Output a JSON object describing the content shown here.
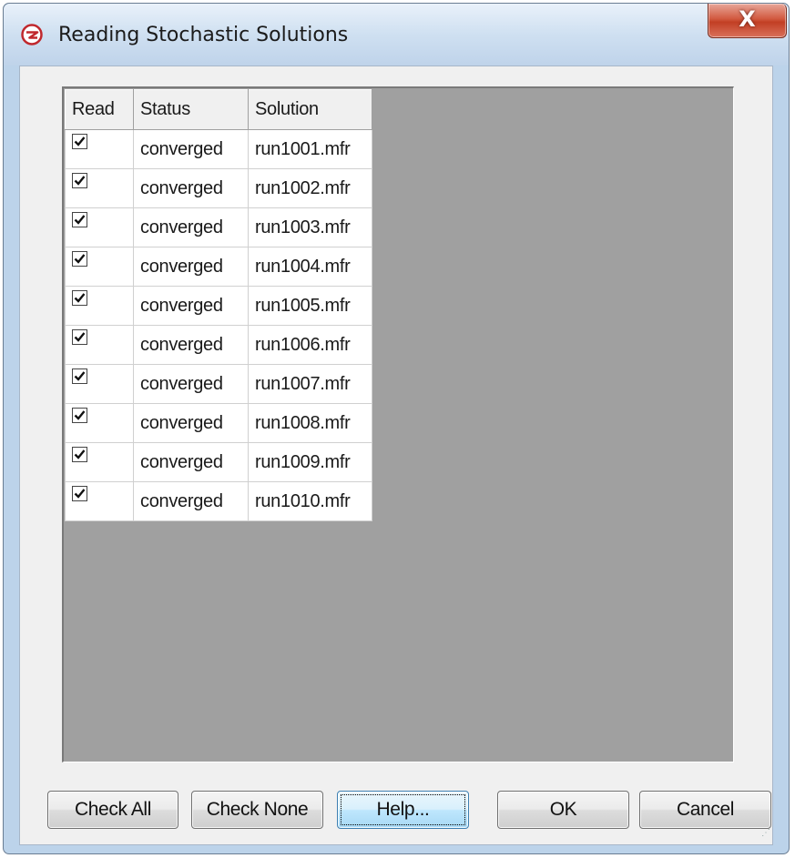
{
  "window": {
    "title": "Reading Stochastic Solutions",
    "close_label": "X"
  },
  "grid": {
    "columns": [
      "Read",
      "Status",
      "Solution"
    ],
    "rows": [
      {
        "read": true,
        "status": "converged",
        "solution": "run1001.mfr"
      },
      {
        "read": true,
        "status": "converged",
        "solution": "run1002.mfr"
      },
      {
        "read": true,
        "status": "converged",
        "solution": "run1003.mfr"
      },
      {
        "read": true,
        "status": "converged",
        "solution": "run1004.mfr"
      },
      {
        "read": true,
        "status": "converged",
        "solution": "run1005.mfr"
      },
      {
        "read": true,
        "status": "converged",
        "solution": "run1006.mfr"
      },
      {
        "read": true,
        "status": "converged",
        "solution": "run1007.mfr"
      },
      {
        "read": true,
        "status": "converged",
        "solution": "run1008.mfr"
      },
      {
        "read": true,
        "status": "converged",
        "solution": "run1009.mfr"
      },
      {
        "read": true,
        "status": "converged",
        "solution": "run1010.mfr"
      }
    ]
  },
  "buttons": {
    "check_all": "Check All",
    "check_none": "Check None",
    "help": "Help...",
    "ok": "OK",
    "cancel": "Cancel"
  },
  "colors": {
    "grid_background": "#a0a0a0",
    "close_button": "#c94a32",
    "app_icon": "#c0282d"
  }
}
